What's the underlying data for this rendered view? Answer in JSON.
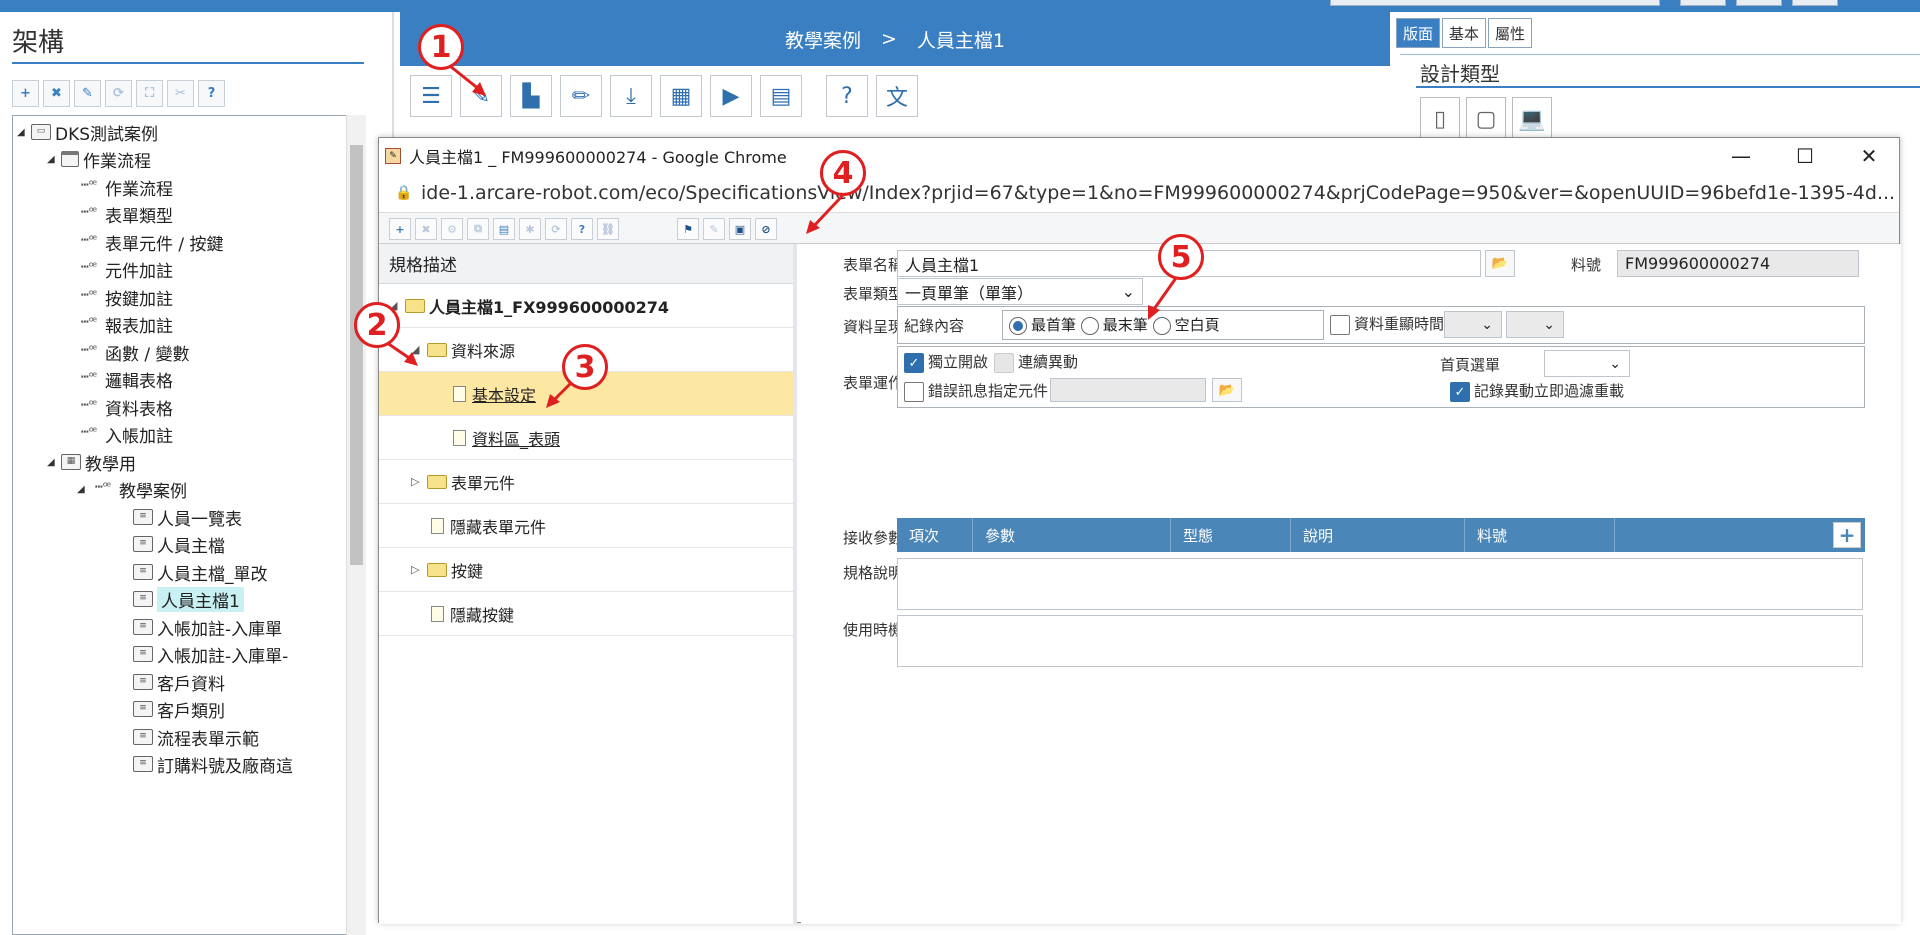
{
  "left_panel": {
    "title": "架構",
    "toolbar": [
      "+",
      "✖",
      "✎",
      "⟳",
      "⛶",
      "✂",
      "?"
    ],
    "tree": [
      {
        "label": "DKS測試案例",
        "level": 0
      },
      {
        "label": "作業流程",
        "level": 1
      },
      {
        "label": "作業流程",
        "level": 2
      },
      {
        "label": "表單類型",
        "level": 2
      },
      {
        "label": "表單元件 / 按鍵",
        "level": 2
      },
      {
        "label": "元件加註",
        "level": 2
      },
      {
        "label": "按鍵加註",
        "level": 2
      },
      {
        "label": "報表加註",
        "level": 2
      },
      {
        "label": "函數 / 變數",
        "level": 2
      },
      {
        "label": "邏輯表格",
        "level": 2
      },
      {
        "label": "資料表格",
        "level": 2
      },
      {
        "label": "入帳加註",
        "level": 2
      },
      {
        "label": "教學用",
        "level": 1
      },
      {
        "label": "教學案例",
        "level": 2
      },
      {
        "label": "人員一覽表",
        "level": 3
      },
      {
        "label": "人員主檔",
        "level": 3
      },
      {
        "label": "人員主檔_單改",
        "level": 3
      },
      {
        "label": "人員主檔1",
        "level": 3,
        "selected": true
      },
      {
        "label": "入帳加註-入庫單",
        "level": 3
      },
      {
        "label": "入帳加註-入庫單-",
        "level": 3
      },
      {
        "label": "客戶資料",
        "level": 3
      },
      {
        "label": "客戶類別",
        "level": 3
      },
      {
        "label": "流程表單示範",
        "level": 3
      },
      {
        "label": "訂購料號及廠商這",
        "level": 3
      }
    ]
  },
  "middle": {
    "breadcrumb_root": "教學案例",
    "breadcrumb_sep": ">",
    "breadcrumb_current": "人員主檔1"
  },
  "right_panel": {
    "tabs": [
      "版面",
      "基本",
      "屬性"
    ],
    "title": "設計類型"
  },
  "popup": {
    "window_title": "人員主檔1 _ FM999600000274 - Google Chrome",
    "url": "ide-1.arcare-robot.com/eco/SpecificationsView/Index?prjid=67&type=1&no=FM999600000274&prjCodePage=950&ver=&openUUID=96befd1e-1395-4d...",
    "controls": {
      "minimize": "—",
      "maximize": "☐",
      "close": "✕"
    },
    "spec_header": "規格描述",
    "spec_tree": {
      "root": "人員主檔1_FX999600000274",
      "data_source": "資料來源",
      "basic_settings": "基本設定",
      "data_area_header": "資料區_表頭",
      "form_elements": "表單元件",
      "hidden_form_elements": "隱藏表單元件",
      "buttons": "按鍵",
      "hidden_buttons": "隱藏按鍵"
    },
    "form": {
      "form_name_label": "表單名稱",
      "form_name_value": "人員主檔1",
      "item_no_label": "料號",
      "item_no_value": "FM999600000274",
      "form_type_label": "表單類型",
      "form_type_value": "一頁單筆（單筆）",
      "data_display_label": "資料呈現",
      "record_content_label": "紀錄內容",
      "radio_first": "最首筆",
      "radio_last": "最末筆",
      "radio_blank": "空白頁",
      "data_repeat_time": "資料重顯時間",
      "form_op_label": "表單運作",
      "open_independent": "獨立開啟",
      "continuous_change": "連續異動",
      "error_msg_element": "錯誤訊息指定元件",
      "home_menu": "首頁選單",
      "record_change_reload": "記錄異動立即過濾重載",
      "recv_params_label": "接收參數",
      "table_headers": [
        "項次",
        "參數",
        "型態",
        "說明",
        "料號"
      ],
      "spec_desc_label": "規格說明",
      "usage_label": "使用時機"
    }
  },
  "annotations": [
    "1",
    "2",
    "3",
    "4",
    "5"
  ],
  "colors": {
    "accent": "#3b7fc3",
    "selected_row": "#fde8a3",
    "annotation": "#e02020",
    "table_header": "#4a86b8"
  }
}
